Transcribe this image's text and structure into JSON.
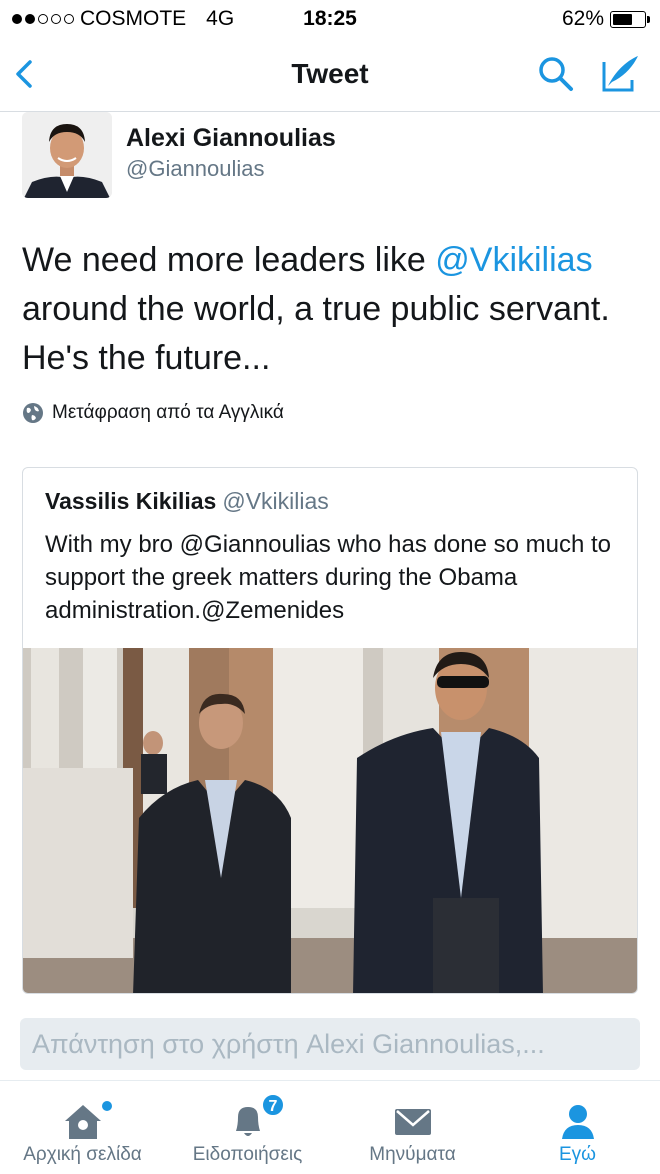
{
  "status_bar": {
    "carrier": "COSMOTE",
    "network": "4G",
    "time": "18:25",
    "battery": "62%",
    "battery_level": 0.62,
    "signal_bars_filled": 2,
    "signal_bars_total": 5
  },
  "nav": {
    "title": "Tweet",
    "back_icon": "chevron-left-icon",
    "search_icon": "search-icon",
    "compose_icon": "compose-icon",
    "accent": "#1b95e0"
  },
  "tweet": {
    "author_name": "Alexi Giannoulias",
    "author_handle": "@Giannoulias",
    "text_before": "We need more leaders like ",
    "mention": "@Vkikilias",
    "text_after": " around the world, a true public servant. He's the future...",
    "translate_label": "Μετάφραση από τα Αγγλικά"
  },
  "quote": {
    "name": "Vassilis Kikilias",
    "handle": "@Vkikilias",
    "text": "With my bro @Giannoulias who has done so much to support the greek matters during the Obama administration.@Zemenides"
  },
  "reply": {
    "placeholder": "Απάντηση στο χρήστη Alexi Giannoulias,..."
  },
  "tabs": [
    {
      "label": "Αρχική σελίδα",
      "icon": "home-icon"
    },
    {
      "label": "Ειδοποιήσεις",
      "icon": "bell-icon",
      "badge": "7"
    },
    {
      "label": "Μηνύματα",
      "icon": "envelope-icon"
    },
    {
      "label": "Εγώ",
      "icon": "person-icon",
      "active": true
    }
  ]
}
